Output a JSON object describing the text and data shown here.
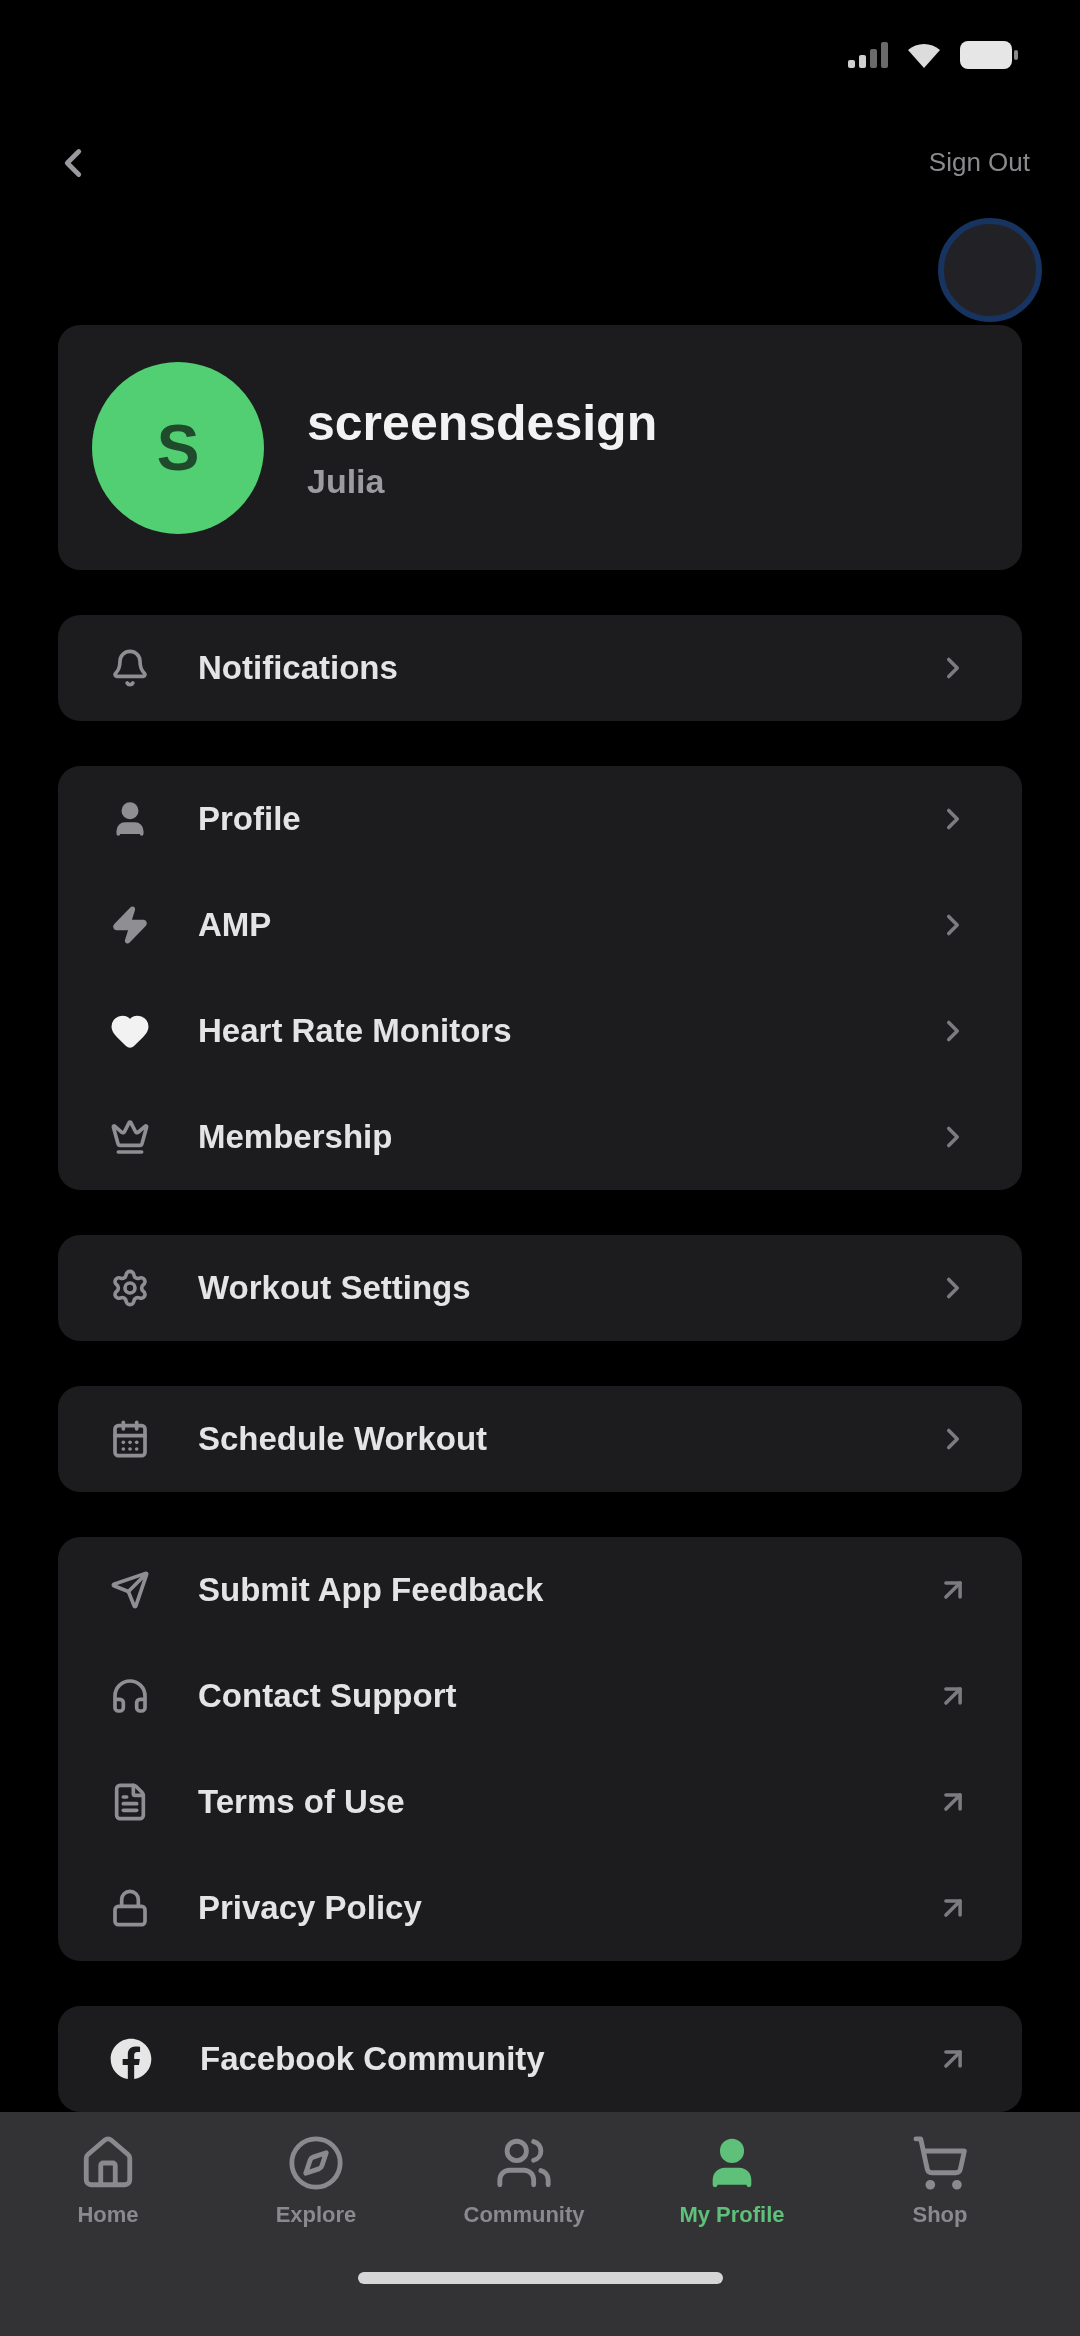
{
  "header": {
    "action": "Sign Out"
  },
  "profile": {
    "initial": "S",
    "username": "screensdesign",
    "name": "Julia"
  },
  "menu_groups": [
    {
      "items": [
        {
          "label": "Notifications",
          "kind": "chevron"
        }
      ]
    },
    {
      "items": [
        {
          "label": "Profile",
          "kind": "chevron"
        },
        {
          "label": "AMP",
          "kind": "chevron"
        },
        {
          "label": "Heart Rate Monitors",
          "kind": "chevron"
        },
        {
          "label": "Membership",
          "kind": "chevron"
        }
      ]
    },
    {
      "items": [
        {
          "label": "Workout Settings",
          "kind": "chevron"
        }
      ]
    },
    {
      "items": [
        {
          "label": "Schedule Workout",
          "kind": "chevron"
        }
      ]
    },
    {
      "items": [
        {
          "label": "Submit App Feedback",
          "kind": "external"
        },
        {
          "label": "Contact Support",
          "kind": "external"
        },
        {
          "label": "Terms of Use",
          "kind": "external"
        },
        {
          "label": "Privacy Policy",
          "kind": "external"
        }
      ]
    },
    {
      "items": [
        {
          "label": "Facebook Community",
          "kind": "external"
        }
      ]
    }
  ],
  "tab_bar": {
    "tabs": [
      {
        "label": "Home",
        "selected": false
      },
      {
        "label": "Explore",
        "selected": false
      },
      {
        "label": "Community",
        "selected": false
      },
      {
        "label": "My Profile",
        "selected": true
      },
      {
        "label": "Shop",
        "selected": false
      }
    ]
  }
}
